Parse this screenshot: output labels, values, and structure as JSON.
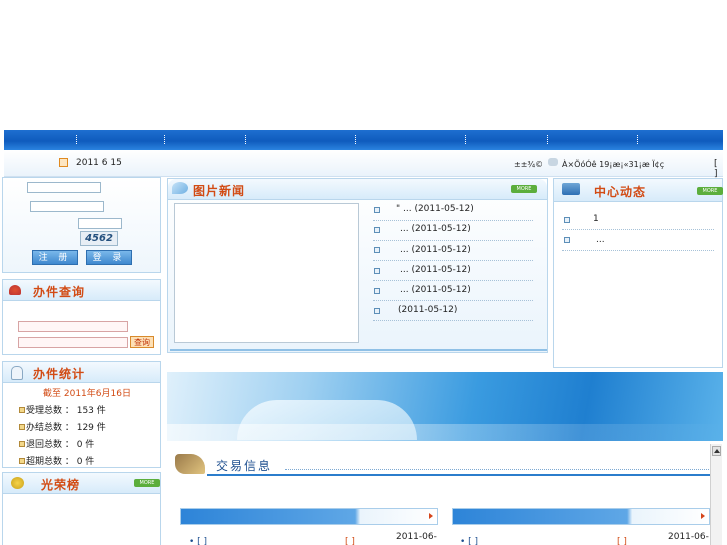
{
  "infobar": {
    "date": "2011 6 15",
    "weather": "±±¾©",
    "weather2": "À×ÕóÓê 19¡æ¡«31¡æ Ï¢ç",
    "bracket": "[ ]"
  },
  "login": {
    "register_label": "注 册",
    "login_label": "登 录",
    "captcha": "4562"
  },
  "query": {
    "title": "办件查询",
    "button": "查询"
  },
  "stats": {
    "title": "办件统计",
    "date": "截至 2011年6月16日",
    "rows": [
      "受理总数 ： 153 件",
      "办结总数 ： 129 件",
      "退回总数 ： 0 件",
      "超期总数 ： 0 件"
    ]
  },
  "honor": {
    "title": "光荣榜",
    "more": "MORE"
  },
  "photo_news": {
    "title": "图片新闻",
    "more": "MORE",
    "items": [
      "\" ... (2011-05-12)",
      "... (2011-05-12)",
      "... (2011-05-12)",
      "... (2011-05-12)",
      "... (2011-05-12)",
      "(2011-05-12)"
    ]
  },
  "center": {
    "title": "中心动态",
    "more": "MORE",
    "items": [
      "1",
      "..."
    ]
  },
  "trade": {
    "title": "交易信息"
  },
  "bottom": {
    "left_row": "• [ ]",
    "left_bracket": "[ ]",
    "left_date": "2011-06-",
    "right_row": "• [ ]",
    "right_bracket": "[ ]",
    "right_date": "2011-06-"
  },
  "colors": {
    "nav": "#1565c8",
    "title_orange": "#d24b14",
    "panel_border": "#b9d6ec"
  }
}
